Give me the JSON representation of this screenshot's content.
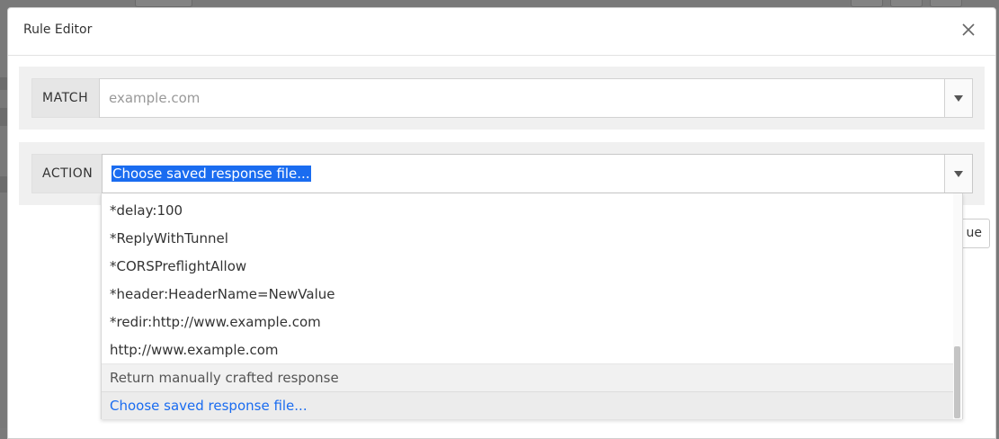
{
  "dialog": {
    "title": "Rule Editor"
  },
  "match": {
    "label": "MATCH",
    "placeholder": "example.com"
  },
  "action": {
    "label": "ACTION",
    "value": "Choose saved response file..."
  },
  "background": {
    "partial_button_label": "ue"
  },
  "dropdown": {
    "items": [
      "*delay:100",
      "*ReplyWithTunnel",
      "*CORSPreflightAllow",
      "*header:HeaderName=NewValue",
      "*redir:http://www.example.com",
      "http://www.example.com",
      "Return manually crafted response",
      "Choose saved response file..."
    ],
    "selected_index": 7
  },
  "colors": {
    "accent": "#1a6cf0",
    "backdrop": "#797979"
  },
  "icons": {
    "close": "close-icon",
    "dropdown_arrow": "chevron-down-icon"
  }
}
